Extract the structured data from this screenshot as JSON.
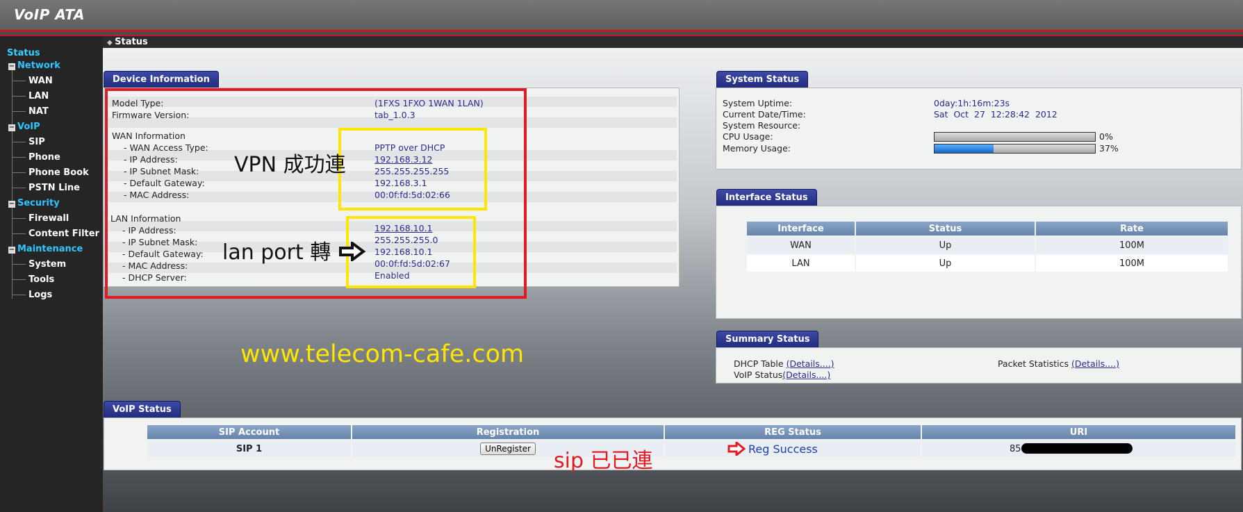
{
  "header": {
    "title": "VoIP ATA"
  },
  "breadcrumb": {
    "label": "Status"
  },
  "sidebar": {
    "root": "Status",
    "groups": [
      {
        "label": "Network",
        "items": [
          "WAN",
          "LAN",
          "NAT"
        ]
      },
      {
        "label": "VoIP",
        "items": [
          "SIP",
          "Phone",
          "Phone Book",
          "PSTN Line"
        ]
      },
      {
        "label": "Security",
        "items": [
          "Firewall",
          "Content Filter"
        ]
      },
      {
        "label": "Maintenance",
        "items": [
          "System",
          "Tools",
          "Logs"
        ]
      }
    ]
  },
  "device_info": {
    "tab": "Device Information",
    "model_label": "Model Type:",
    "model_value": "(1FXS 1FXO 1WAN 1LAN)",
    "firmware_label": "Firmware Version:",
    "firmware_value": "tab_1.0.3",
    "wan_header": "WAN Information",
    "wan": [
      {
        "label": "- WAN Access Type:",
        "value": "PPTP over DHCP"
      },
      {
        "label": "- IP Address:",
        "value": "192.168.3.12"
      },
      {
        "label": "- IP Subnet Mask:",
        "value": "255.255.255.255"
      },
      {
        "label": "- Default Gateway:",
        "value": "192.168.3.1"
      },
      {
        "label": "- MAC Address:",
        "value": "00:0f:fd:5d:02:66"
      }
    ],
    "lan_header": "LAN Information",
    "lan": [
      {
        "label": "- IP Address:",
        "value": "192.168.10.1"
      },
      {
        "label": "- IP Subnet Mask:",
        "value": "255.255.255.0"
      },
      {
        "label": "- Default Gateway:",
        "value": "192.168.10.1"
      },
      {
        "label": "- MAC Address:",
        "value": "00:0f:fd:5d:02:67"
      },
      {
        "label": "- DHCP Server:",
        "value": "Enabled"
      }
    ]
  },
  "system_status": {
    "tab": "System Status",
    "uptime_label": "System Uptime:",
    "uptime_value": "0day:1h:16m:23s",
    "datetime_label": "Current Date/Time:",
    "datetime_value": "Sat  Oct  27  12:28:42  2012",
    "resource_label": "System Resource:",
    "cpu_label": "CPU Usage:",
    "cpu_text": "0%",
    "cpu_fraction": 0.0,
    "mem_label": "Memory Usage:",
    "mem_text": "37%",
    "mem_fraction": 0.37
  },
  "interface_status": {
    "tab": "Interface Status",
    "columns": [
      "Interface",
      "Status",
      "Rate"
    ],
    "rows": [
      [
        "WAN",
        "Up",
        "100M"
      ],
      [
        "LAN",
        "Up",
        "100M"
      ]
    ]
  },
  "summary_status": {
    "tab": "Summary Status",
    "dhcp_label": "DHCP Table ",
    "dhcp_link": "(Details....)",
    "voip_label": "VoIP Status",
    "voip_link": "(Details....)",
    "packet_label": "Packet Statistics ",
    "packet_link": "(Details....)"
  },
  "voip_status": {
    "tab": "VoIP Status",
    "columns": [
      "SIP Account",
      "Registration",
      "REG Status",
      "URI"
    ],
    "account": "SIP 1",
    "button": "UnRegister",
    "reg_status": "Reg Success",
    "uri_prefix": "85"
  },
  "annotations": {
    "vpn": "VPN 成功連",
    "lan_port": "lan port 轉",
    "site": "www.telecom-cafe.com",
    "sip": "sip 已已連"
  },
  "colors": {
    "accent_red": "#c8161d",
    "annotation_red": "#e01b24",
    "annotation_yellow": "#ffe600",
    "tab_blue": "#2a3590"
  }
}
